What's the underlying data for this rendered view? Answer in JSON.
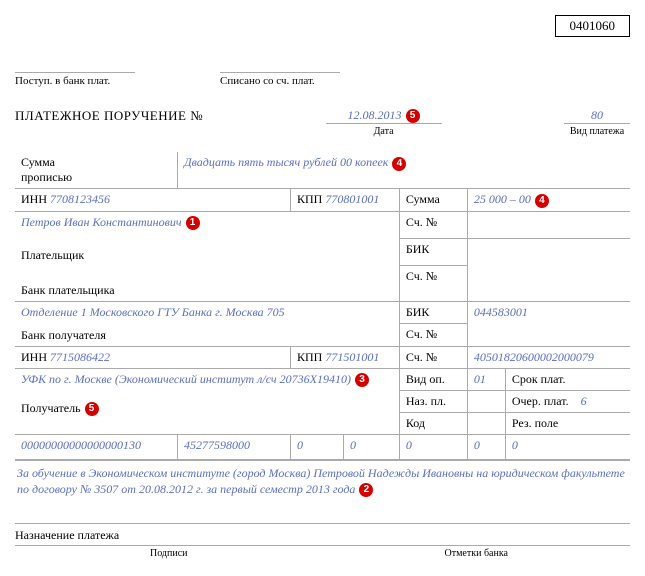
{
  "form_code": "0401060",
  "header": {
    "received": "Поступ. в банк плат.",
    "debited": "Списано со сч. плат."
  },
  "title": "ПЛАТЕЖНОЕ ПОРУЧЕНИЕ №",
  "date": {
    "value": "12.08.2013",
    "label": "Дата",
    "badge": "5"
  },
  "payment_type": {
    "value": "80",
    "label": "Вид платежа"
  },
  "sum_words": {
    "label": "Сумма\nпрописью",
    "value": "Двадцать пять тысяч рублей 00 копеек",
    "badge": "4"
  },
  "payer": {
    "inn_lbl": "ИНН",
    "inn": "7708123456",
    "kpp_lbl": "КПП",
    "kpp": "770801001",
    "name": "Петров Иван Константинович",
    "badge": "1",
    "role_lbl": "Плательщик"
  },
  "sum": {
    "label": "Сумма",
    "value": "25 000 – 00",
    "badge": "4"
  },
  "sch_lbl": "Сч. №",
  "bik_lbl": "БИК",
  "payer_bank": {
    "label": "Банк плательщика"
  },
  "benef_branch": {
    "name": "Отделение 1 Московского ГТУ Банка г. Москва 705",
    "bik": "044583001"
  },
  "benef_bank_lbl": "Банк получателя",
  "benef": {
    "inn_lbl": "ИНН",
    "inn": "7715086422",
    "kpp_lbl": "КПП",
    "kpp": "771501001",
    "sch": "40501820600002000079",
    "name": "УФК по г. Москве (Экономический институт л/сч 20736X19410)",
    "badge": "3",
    "role_lbl": "Получатель",
    "role_badge": "5"
  },
  "ops": {
    "vid_op_lbl": "Вид оп.",
    "vid_op": "01",
    "srok_lbl": "Срок плат.",
    "naz_pl_lbl": "Наз. пл.",
    "ocher_lbl": "Очер. плат.",
    "ocher": "6",
    "kod_lbl": "Код",
    "rez_lbl": "Рез. поле"
  },
  "codes": [
    "00000000000000000130",
    "45277598000",
    "0",
    "0",
    "0",
    "0",
    "0"
  ],
  "purpose": {
    "text": "За обучение  в Экономическом институте (город Москва) Петровой Надежды Ивановны на юридическом факультете по договору № 3507 от 20.08.2012 г. за первый семестр 2013 года",
    "badge": "2"
  },
  "footer": {
    "naz": "Назначение платежа",
    "sign": "Подписи",
    "bank": "Отметки банка"
  }
}
